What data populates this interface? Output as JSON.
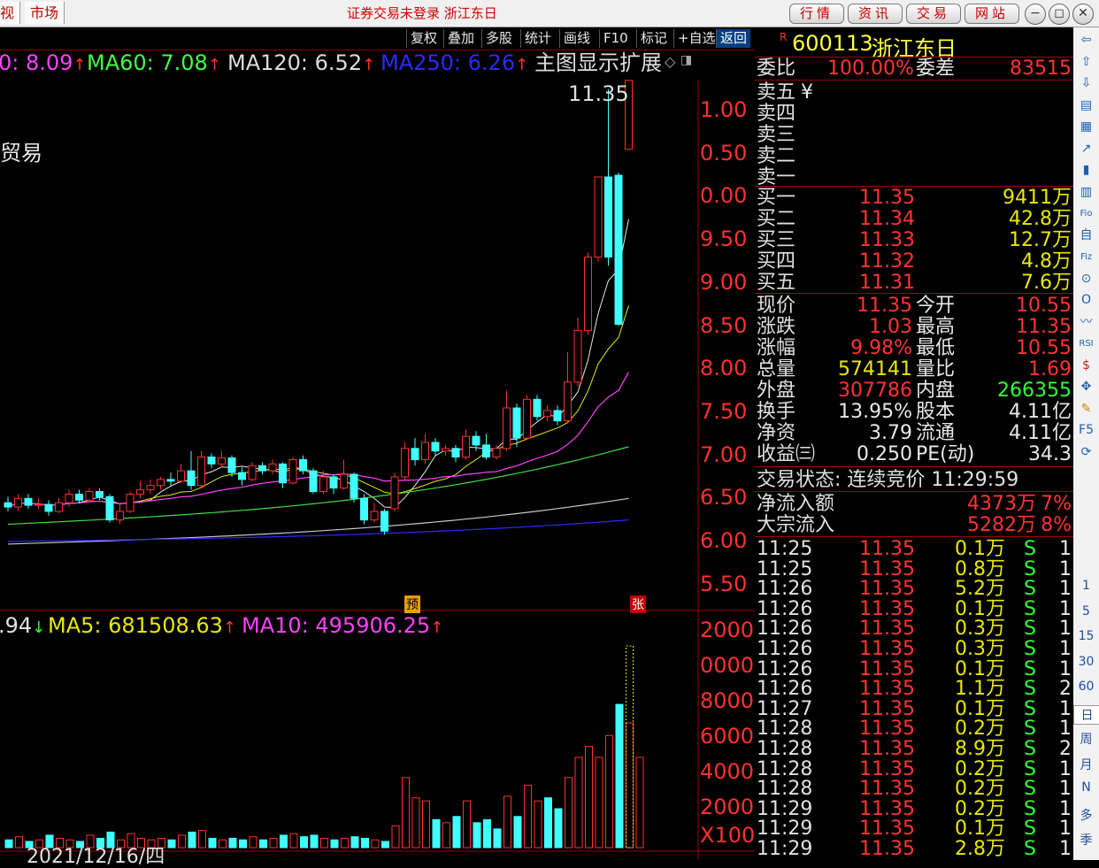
{
  "titlebar": {
    "tab_left": "视",
    "tab_market": "市场",
    "title": "证券交易未登录  浙江东日",
    "buttons": [
      "行情",
      "资讯",
      "交易",
      "网站"
    ],
    "win_controls": [
      "−",
      "◻",
      "✕"
    ]
  },
  "toolbar": {
    "items": [
      "复权",
      "叠加",
      "多股",
      "统计",
      "画线",
      "F10",
      "标记",
      "+自选",
      "返回"
    ],
    "active": "返回"
  },
  "ma": {
    "ma30": "0: 8.09",
    "ma60": "MA60: 7.08",
    "ma120": "MA120: 6.52",
    "ma250": "MA250: 6.26",
    "menu": "主图显示扩展",
    "vol_ma0": ".94",
    "vol_ma5": "MA5: 681508.63",
    "vol_ma10": "MA10: 495906.25",
    "up_arrow": "↑",
    "down_arrow": "↓"
  },
  "chart_labels": {
    "partial_name": "贸易",
    "peak": "11.35",
    "marker_yu": "预",
    "marker_zhang": "张",
    "date": "2021/12/16/四",
    "unit": "X100"
  },
  "chart_data": {
    "type": "candlestick",
    "price_axis": [
      "1.00",
      "0.50",
      "0.00",
      "9.50",
      "9.00",
      "8.50",
      "8.00",
      "7.50",
      "7.00",
      "6.50",
      "6.00",
      "5.50"
    ],
    "volume_axis": [
      "2000",
      "0000",
      "8000",
      "6000",
      "4000",
      "2000"
    ],
    "ylim": [
      5.3,
      11.5
    ],
    "candles": [
      {
        "o": 6.45,
        "c": 6.4,
        "h": 6.52,
        "l": 6.35
      },
      {
        "o": 6.4,
        "c": 6.5,
        "h": 6.55,
        "l": 6.36
      },
      {
        "o": 6.5,
        "c": 6.42,
        "h": 6.55,
        "l": 6.38
      },
      {
        "o": 6.42,
        "c": 6.43,
        "h": 6.5,
        "l": 6.38
      },
      {
        "o": 6.43,
        "c": 6.35,
        "h": 6.48,
        "l": 6.3
      },
      {
        "o": 6.35,
        "c": 6.45,
        "h": 6.5,
        "l": 6.33
      },
      {
        "o": 6.45,
        "c": 6.55,
        "h": 6.6,
        "l": 6.4
      },
      {
        "o": 6.55,
        "c": 6.48,
        "h": 6.6,
        "l": 6.44
      },
      {
        "o": 6.48,
        "c": 6.58,
        "h": 6.62,
        "l": 6.45
      },
      {
        "o": 6.58,
        "c": 6.52,
        "h": 6.62,
        "l": 6.48
      },
      {
        "o": 6.52,
        "c": 6.25,
        "h": 6.55,
        "l": 6.22
      },
      {
        "o": 6.25,
        "c": 6.35,
        "h": 6.45,
        "l": 6.2
      },
      {
        "o": 6.35,
        "c": 6.55,
        "h": 6.58,
        "l": 6.33
      },
      {
        "o": 6.55,
        "c": 6.6,
        "h": 6.7,
        "l": 6.5
      },
      {
        "o": 6.6,
        "c": 6.65,
        "h": 6.72,
        "l": 6.55
      },
      {
        "o": 6.65,
        "c": 6.72,
        "h": 6.75,
        "l": 6.6
      },
      {
        "o": 6.72,
        "c": 6.7,
        "h": 6.8,
        "l": 6.65
      },
      {
        "o": 6.7,
        "c": 6.82,
        "h": 6.9,
        "l": 6.68
      },
      {
        "o": 6.82,
        "c": 6.65,
        "h": 7.05,
        "l": 6.6
      },
      {
        "o": 6.65,
        "c": 6.98,
        "h": 7.05,
        "l": 6.63
      },
      {
        "o": 6.98,
        "c": 6.9,
        "h": 7.02,
        "l": 6.85
      },
      {
        "o": 6.9,
        "c": 6.97,
        "h": 7.05,
        "l": 6.86
      },
      {
        "o": 6.97,
        "c": 6.8,
        "h": 7.0,
        "l": 6.75
      },
      {
        "o": 6.8,
        "c": 6.72,
        "h": 6.86,
        "l": 6.65
      },
      {
        "o": 6.72,
        "c": 6.88,
        "h": 6.92,
        "l": 6.7
      },
      {
        "o": 6.88,
        "c": 6.82,
        "h": 6.92,
        "l": 6.78
      },
      {
        "o": 6.82,
        "c": 6.9,
        "h": 6.95,
        "l": 6.78
      },
      {
        "o": 6.9,
        "c": 6.68,
        "h": 6.92,
        "l": 6.62
      },
      {
        "o": 6.68,
        "c": 6.95,
        "h": 6.98,
        "l": 6.66
      },
      {
        "o": 6.95,
        "c": 6.82,
        "h": 7.0,
        "l": 6.78
      },
      {
        "o": 6.82,
        "c": 6.58,
        "h": 6.85,
        "l": 6.55
      },
      {
        "o": 6.58,
        "c": 6.75,
        "h": 6.82,
        "l": 6.55
      },
      {
        "o": 6.75,
        "c": 6.62,
        "h": 6.78,
        "l": 6.55
      },
      {
        "o": 6.62,
        "c": 6.78,
        "h": 6.95,
        "l": 6.6
      },
      {
        "o": 6.78,
        "c": 6.5,
        "h": 6.8,
        "l": 6.45
      },
      {
        "o": 6.5,
        "c": 6.25,
        "h": 6.55,
        "l": 6.2
      },
      {
        "o": 6.25,
        "c": 6.35,
        "h": 6.45,
        "l": 6.22
      },
      {
        "o": 6.35,
        "c": 6.12,
        "h": 6.38,
        "l": 6.08
      },
      {
        "o": 6.38,
        "c": 6.75,
        "h": 6.8,
        "l": 6.35
      },
      {
        "o": 6.75,
        "c": 7.08,
        "h": 7.15,
        "l": 6.72
      },
      {
        "o": 7.08,
        "c": 6.95,
        "h": 7.2,
        "l": 6.88
      },
      {
        "o": 6.95,
        "c": 7.15,
        "h": 7.25,
        "l": 6.9
      },
      {
        "o": 7.15,
        "c": 7.05,
        "h": 7.2,
        "l": 7.0
      },
      {
        "o": 7.05,
        "c": 7.08,
        "h": 7.12,
        "l": 7.0
      },
      {
        "o": 7.08,
        "c": 6.98,
        "h": 7.12,
        "l": 6.92
      },
      {
        "o": 6.98,
        "c": 7.22,
        "h": 7.3,
        "l": 6.95
      },
      {
        "o": 7.22,
        "c": 7.12,
        "h": 7.28,
        "l": 7.05
      },
      {
        "o": 7.12,
        "c": 6.98,
        "h": 7.25,
        "l": 6.95
      },
      {
        "o": 6.98,
        "c": 7.08,
        "h": 7.12,
        "l": 6.95
      },
      {
        "o": 7.08,
        "c": 7.55,
        "h": 7.75,
        "l": 7.05
      },
      {
        "o": 7.55,
        "c": 7.2,
        "h": 7.6,
        "l": 7.1
      },
      {
        "o": 7.2,
        "c": 7.65,
        "h": 7.7,
        "l": 7.18
      },
      {
        "o": 7.65,
        "c": 7.45,
        "h": 7.7,
        "l": 7.4
      },
      {
        "o": 7.45,
        "c": 7.52,
        "h": 7.58,
        "l": 7.4
      },
      {
        "o": 7.52,
        "c": 7.4,
        "h": 7.58,
        "l": 7.35
      },
      {
        "o": 7.4,
        "c": 7.85,
        "h": 8.2,
        "l": 7.38
      },
      {
        "o": 7.85,
        "c": 8.45,
        "h": 8.6,
        "l": 7.8
      },
      {
        "o": 8.45,
        "c": 9.3,
        "h": 9.35,
        "l": 8.4
      },
      {
        "o": 9.3,
        "c": 10.23,
        "h": 10.23,
        "l": 9.25
      },
      {
        "o": 10.23,
        "c": 9.3,
        "h": 11.25,
        "l": 9.2
      },
      {
        "o": 10.25,
        "c": 8.52,
        "h": 10.28,
        "l": 8.5
      },
      {
        "o": 10.55,
        "c": 11.35,
        "h": 11.35,
        "l": 10.55
      }
    ],
    "volumes": [
      {
        "v": 0.05,
        "up": false
      },
      {
        "v": 0.07,
        "up": true
      },
      {
        "v": 0.04,
        "up": false
      },
      {
        "v": 0.05,
        "up": true
      },
      {
        "v": 0.08,
        "up": false
      },
      {
        "v": 0.06,
        "up": true
      },
      {
        "v": 0.05,
        "up": true
      },
      {
        "v": 0.04,
        "up": false
      },
      {
        "v": 0.08,
        "up": true
      },
      {
        "v": 0.06,
        "up": false
      },
      {
        "v": 0.1,
        "up": false
      },
      {
        "v": 0.05,
        "up": true
      },
      {
        "v": 0.09,
        "up": true
      },
      {
        "v": 0.06,
        "up": true
      },
      {
        "v": 0.05,
        "up": true
      },
      {
        "v": 0.06,
        "up": true
      },
      {
        "v": 0.05,
        "up": false
      },
      {
        "v": 0.08,
        "up": true
      },
      {
        "v": 0.1,
        "up": false
      },
      {
        "v": 0.11,
        "up": true
      },
      {
        "v": 0.06,
        "up": false
      },
      {
        "v": 0.05,
        "up": true
      },
      {
        "v": 0.06,
        "up": false
      },
      {
        "v": 0.05,
        "up": false
      },
      {
        "v": 0.07,
        "up": true
      },
      {
        "v": 0.05,
        "up": false
      },
      {
        "v": 0.06,
        "up": true
      },
      {
        "v": 0.08,
        "up": false
      },
      {
        "v": 0.09,
        "up": true
      },
      {
        "v": 0.07,
        "up": false
      },
      {
        "v": 0.08,
        "up": false
      },
      {
        "v": 0.06,
        "up": true
      },
      {
        "v": 0.05,
        "up": false
      },
      {
        "v": 0.06,
        "up": true
      },
      {
        "v": 0.07,
        "up": false
      },
      {
        "v": 0.06,
        "up": false
      },
      {
        "v": 0.05,
        "up": true
      },
      {
        "v": 0.04,
        "up": false
      },
      {
        "v": 0.14,
        "up": true
      },
      {
        "v": 0.45,
        "up": true
      },
      {
        "v": 0.32,
        "up": true
      },
      {
        "v": 0.3,
        "up": true
      },
      {
        "v": 0.18,
        "up": false
      },
      {
        "v": 0.16,
        "up": true
      },
      {
        "v": 0.2,
        "up": false
      },
      {
        "v": 0.3,
        "up": true
      },
      {
        "v": 0.16,
        "up": false
      },
      {
        "v": 0.18,
        "up": false
      },
      {
        "v": 0.12,
        "up": false
      },
      {
        "v": 0.33,
        "up": true
      },
      {
        "v": 0.2,
        "up": false
      },
      {
        "v": 0.4,
        "up": true
      },
      {
        "v": 0.3,
        "up": true
      },
      {
        "v": 0.32,
        "up": false
      },
      {
        "v": 0.25,
        "up": false
      },
      {
        "v": 0.45,
        "up": true
      },
      {
        "v": 0.58,
        "up": true
      },
      {
        "v": 0.65,
        "up": true
      },
      {
        "v": 0.58,
        "up": true
      },
      {
        "v": 0.72,
        "up": true
      },
      {
        "v": 0.92,
        "up": false
      },
      {
        "v": 0.8,
        "up": true
      },
      {
        "v": 0.58,
        "up": true
      }
    ]
  },
  "quote": {
    "flag": "R",
    "code": "600113",
    "name": "浙江东日",
    "weibi_lbl": "委比",
    "weibi": "100.00%",
    "weicha_lbl": "委差",
    "weicha": "83515",
    "sell": [
      {
        "lbl": "卖五",
        "extra": "¥"
      },
      {
        "lbl": "卖四",
        "extra": ""
      },
      {
        "lbl": "卖三",
        "extra": ""
      },
      {
        "lbl": "卖二",
        "extra": ""
      },
      {
        "lbl": "卖一",
        "extra": ""
      }
    ],
    "buy": [
      {
        "lbl": "买一",
        "price": "11.35",
        "vol": "9411万"
      },
      {
        "lbl": "买二",
        "price": "11.34",
        "vol": "42.8万"
      },
      {
        "lbl": "买三",
        "price": "11.33",
        "vol": "12.7万"
      },
      {
        "lbl": "买四",
        "price": "11.32",
        "vol": "4.8万"
      },
      {
        "lbl": "买五",
        "price": "11.31",
        "vol": "7.6万"
      }
    ],
    "stats": [
      {
        "l1": "现价",
        "v1": "11.35",
        "c1": "red",
        "l2": "今开",
        "v2": "10.55",
        "c2": "red"
      },
      {
        "l1": "涨跌",
        "v1": "1.03",
        "c1": "red",
        "l2": "最高",
        "v2": "11.35",
        "c2": "red"
      },
      {
        "l1": "涨幅",
        "v1": "9.98%",
        "c1": "red",
        "l2": "最低",
        "v2": "10.55",
        "c2": "red"
      },
      {
        "l1": "总量",
        "v1": "574141",
        "c1": "yel",
        "l2": "量比",
        "v2": "1.69",
        "c2": "red"
      },
      {
        "l1": "外盘",
        "v1": "307786",
        "c1": "red",
        "l2": "内盘",
        "v2": "266355",
        "c2": "grn"
      },
      {
        "l1": "换手",
        "v1": "13.95%",
        "c1": "wht",
        "l2": "股本",
        "v2": "4.11亿",
        "c2": "wht"
      },
      {
        "l1": "净资",
        "v1": "3.79",
        "c1": "wht",
        "l2": "流通",
        "v2": "4.11亿",
        "c2": "wht"
      },
      {
        "l1": "收益㈢",
        "v1": "0.250",
        "c1": "wht",
        "l2": "PE(动)",
        "v2": "34.3",
        "c2": "wht"
      }
    ],
    "trade_status": "交易状态: 连续竞价 11:29:59",
    "netflow_lbl": "净流入额",
    "netflow": "4373万",
    "netflow_pct": "7%",
    "block_lbl": "大宗流入",
    "block": "5282万",
    "block_pct": "8%"
  },
  "ticks": [
    {
      "t": "11:25",
      "p": "11.35",
      "v": "0.1万",
      "s": "S",
      "n": "1"
    },
    {
      "t": "11:25",
      "p": "11.35",
      "v": "0.8万",
      "s": "S",
      "n": "1"
    },
    {
      "t": "11:26",
      "p": "11.35",
      "v": "5.2万",
      "s": "S",
      "n": "1"
    },
    {
      "t": "11:26",
      "p": "11.35",
      "v": "0.1万",
      "s": "S",
      "n": "1"
    },
    {
      "t": "11:26",
      "p": "11.35",
      "v": "0.3万",
      "s": "S",
      "n": "1"
    },
    {
      "t": "11:26",
      "p": "11.35",
      "v": "0.3万",
      "s": "S",
      "n": "1"
    },
    {
      "t": "11:26",
      "p": "11.35",
      "v": "0.1万",
      "s": "S",
      "n": "1"
    },
    {
      "t": "11:26",
      "p": "11.35",
      "v": "1.1万",
      "s": "S",
      "n": "2"
    },
    {
      "t": "11:27",
      "p": "11.35",
      "v": "0.1万",
      "s": "S",
      "n": "1"
    },
    {
      "t": "11:28",
      "p": "11.35",
      "v": "0.2万",
      "s": "S",
      "n": "1"
    },
    {
      "t": "11:28",
      "p": "11.35",
      "v": "8.9万",
      "s": "S",
      "n": "2"
    },
    {
      "t": "11:28",
      "p": "11.35",
      "v": "0.2万",
      "s": "S",
      "n": "1"
    },
    {
      "t": "11:28",
      "p": "11.35",
      "v": "0.2万",
      "s": "S",
      "n": "1"
    },
    {
      "t": "11:29",
      "p": "11.35",
      "v": "0.2万",
      "s": "S",
      "n": "1"
    },
    {
      "t": "11:29",
      "p": "11.35",
      "v": "0.1万",
      "s": "S",
      "n": "1"
    },
    {
      "t": "11:29",
      "p": "11.35",
      "v": "2.8万",
      "s": "S",
      "n": "1"
    }
  ],
  "sidebar": {
    "icons": [
      "arrow-left-icon",
      "arrow-up-icon",
      "arrow-down-icon",
      "note-icon",
      "grid-icon",
      "line-chart-icon",
      "candle-icon",
      "bar-chart-icon",
      "f10-icon",
      "news-icon",
      "fiz-icon",
      "magnify-icon",
      "circle-icon",
      "wave-icon",
      "rsi-icon",
      "dollar-icon",
      "move-icon",
      "pencil-icon",
      "f5-icon",
      "refresh-icon"
    ],
    "glyphs": [
      "⇦",
      "⇧",
      "⇩",
      "▤",
      "▦",
      "↗",
      "▮",
      "▥",
      "Fio",
      "自",
      "Fiz",
      "⊙",
      "O",
      "〰",
      "RSI",
      "$",
      "✥",
      "✎",
      "F5",
      "⟳"
    ],
    "periods": [
      "1",
      "5",
      "15",
      "30",
      "60",
      "日",
      "周",
      "月",
      "N",
      "多",
      "季"
    ]
  }
}
